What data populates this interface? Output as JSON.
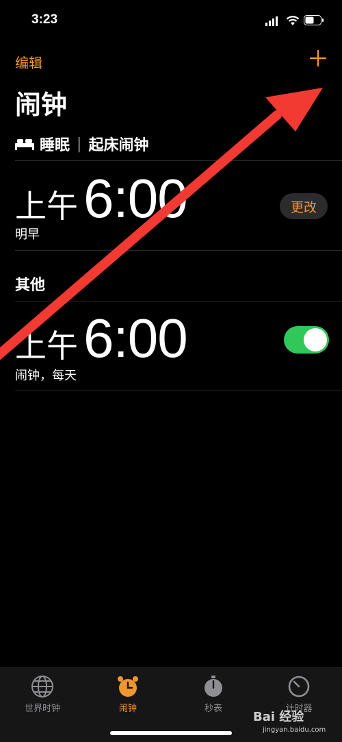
{
  "status_bar": {
    "time": "3:23"
  },
  "nav": {
    "edit_label": "编辑",
    "title": "闹钟"
  },
  "sleep": {
    "label": "睡眠",
    "separator": "|",
    "wake_label": "起床闹钟"
  },
  "sleep_alarm": {
    "ampm": "上午",
    "time": "6:00",
    "subtitle": "明早",
    "change_label": "更改"
  },
  "other_section": "其他",
  "alarms": [
    {
      "ampm": "上午",
      "time": "6:00",
      "subtitle": "闹钟，每天",
      "enabled": true
    }
  ],
  "tabs": [
    {
      "label": "世界时钟",
      "icon": "globe-icon"
    },
    {
      "label": "闹钟",
      "icon": "alarm-clock-icon",
      "active": true
    },
    {
      "label": "秒表",
      "icon": "stopwatch-icon"
    },
    {
      "label": "计时器",
      "icon": "timer-icon"
    }
  ],
  "colors": {
    "accent": "#f0962f",
    "toggle_on": "#32c759",
    "arrow": "#f23a33"
  },
  "watermark": {
    "brand": "Bai 经验",
    "url": "jingyan.baidu.com"
  }
}
